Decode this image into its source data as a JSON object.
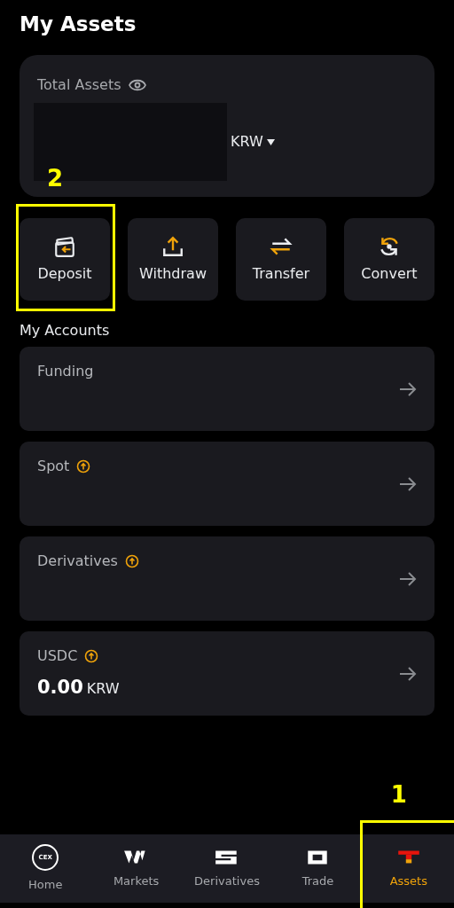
{
  "title": "My Assets",
  "total_assets": {
    "label": "Total Assets",
    "currency": "KRW",
    "redacted": true
  },
  "actions": [
    {
      "label": "Deposit",
      "kind": "deposit",
      "annotation": "2"
    },
    {
      "label": "Withdraw",
      "kind": "withdraw"
    },
    {
      "label": "Transfer",
      "kind": "transfer"
    },
    {
      "label": "Convert",
      "kind": "convert"
    }
  ],
  "accounts_heading": "My Accounts",
  "accounts": [
    {
      "name": "Funding",
      "badge": false
    },
    {
      "name": "Spot",
      "badge": true
    },
    {
      "name": "Derivatives",
      "badge": true
    },
    {
      "name": "USDC",
      "badge": true,
      "amount": "0.00",
      "currency": "KRW"
    }
  ],
  "bottom_nav": [
    {
      "label": "Home",
      "kind": "home",
      "icon_text": "CEX",
      "selected": false
    },
    {
      "label": "Markets",
      "kind": "markets",
      "selected": false
    },
    {
      "label": "Derivatives",
      "kind": "derivatives",
      "selected": false
    },
    {
      "label": "Trade",
      "kind": "trade",
      "selected": false
    },
    {
      "label": "Assets",
      "kind": "assets",
      "selected": true,
      "annotation": "1"
    }
  ]
}
